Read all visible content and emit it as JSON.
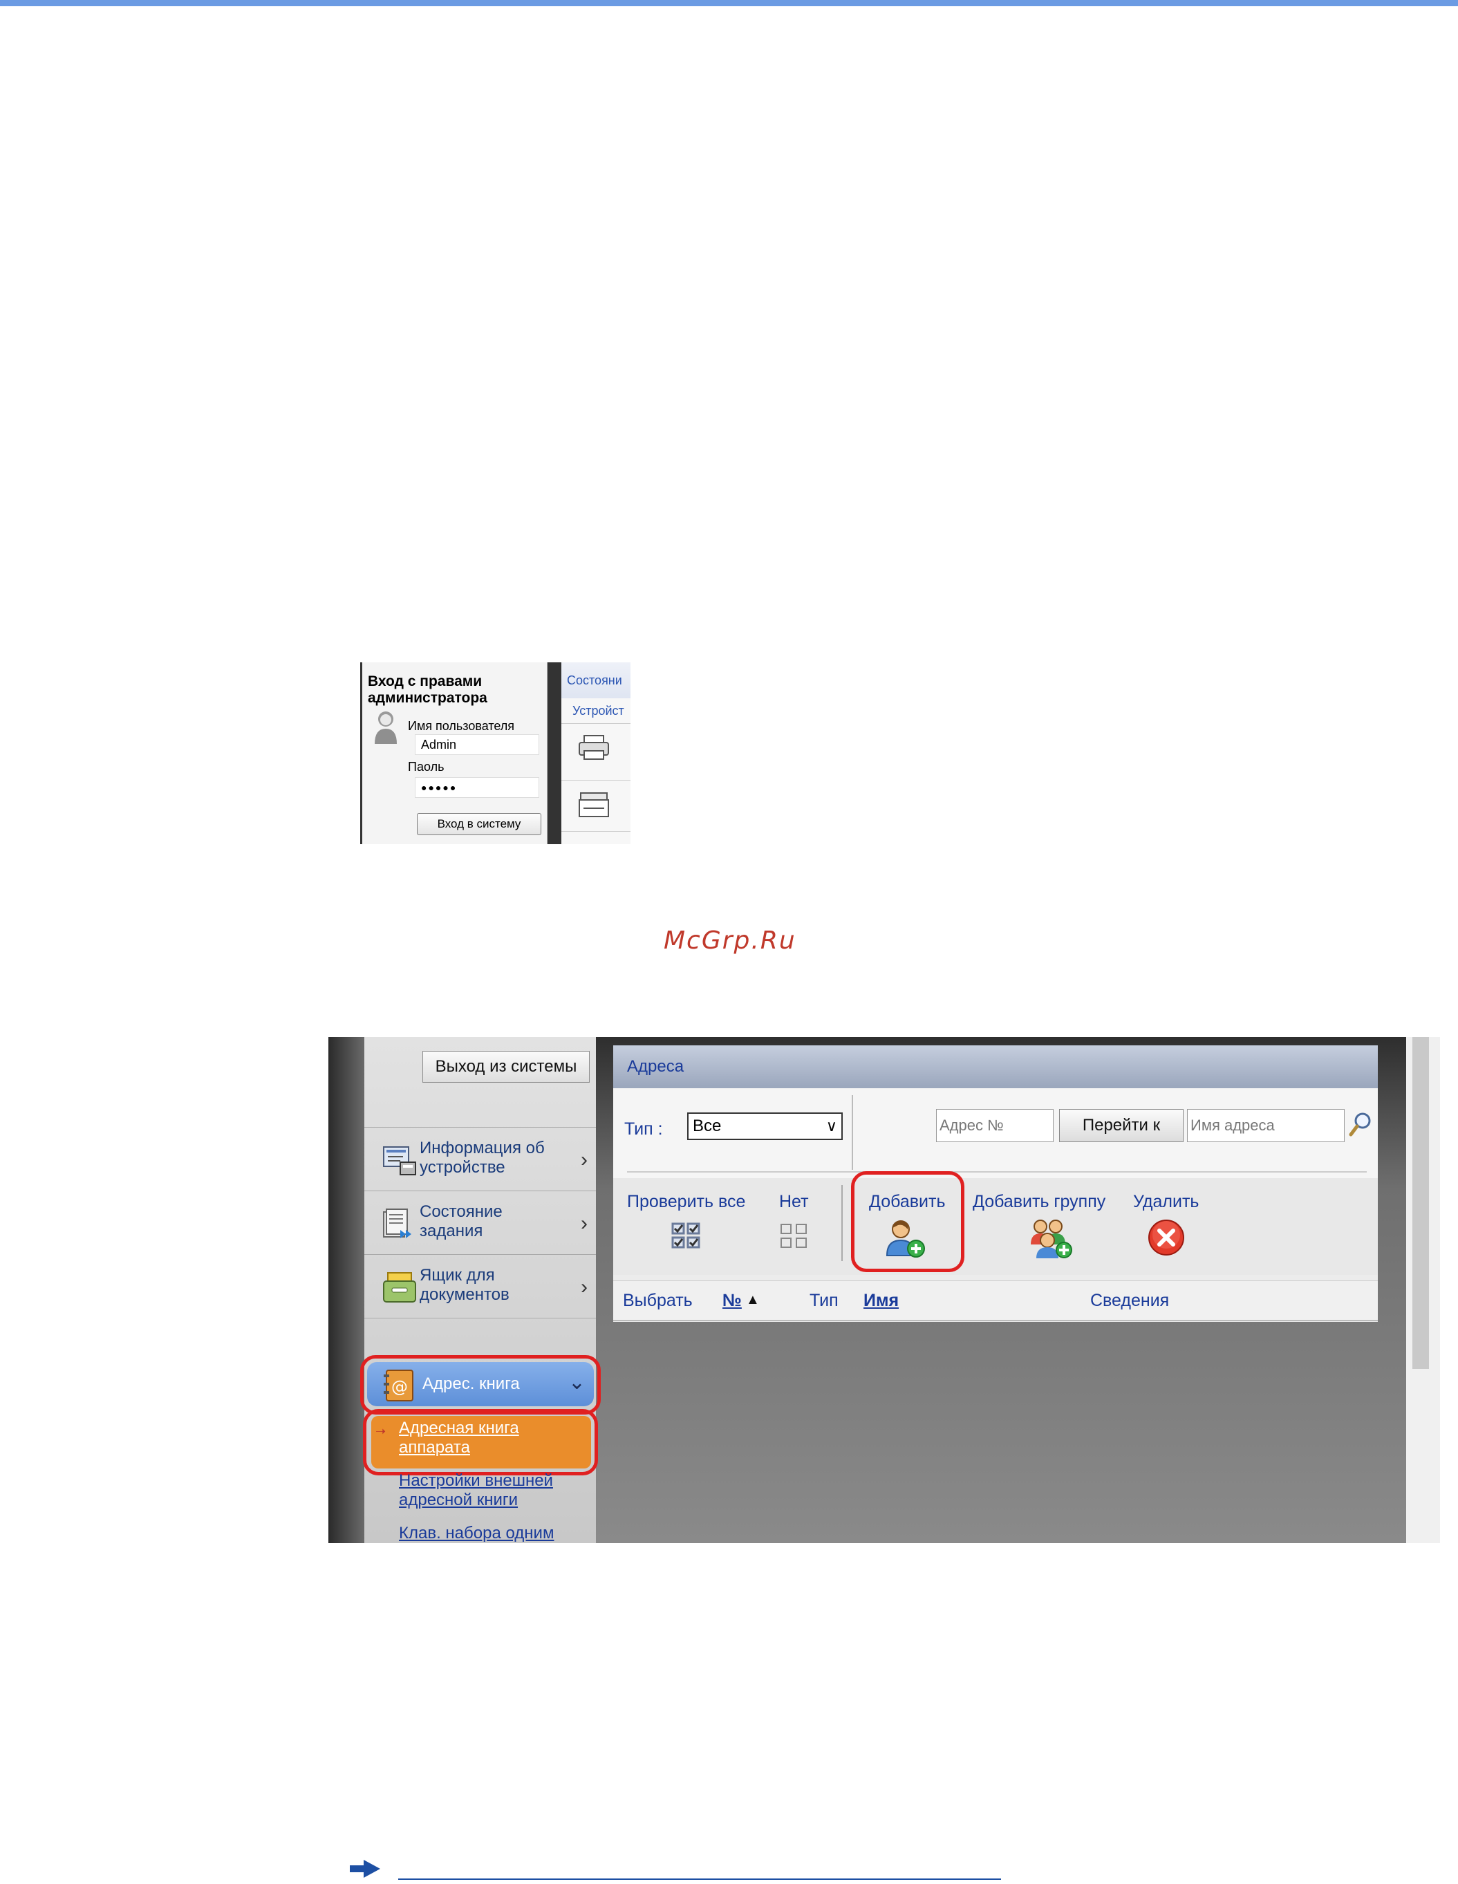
{
  "login": {
    "title": "Вход с правами администратора",
    "username_label": "Имя пользователя",
    "username_value": "Admin",
    "password_label": "Паоль",
    "password_value": "●●●●●",
    "login_button": "Вход в систему",
    "tab_label": "Состояни",
    "subtab_label": "Устройст"
  },
  "watermark": "McGrp.Ru",
  "addressbook": {
    "logout_button": "Выход из системы",
    "nav": [
      {
        "label": "Информация об устройстве",
        "icon": "device-info-icon"
      },
      {
        "label": "Состояние задания",
        "icon": "job-status-icon"
      },
      {
        "label": "Ящик для документов",
        "icon": "document-box-icon"
      },
      {
        "label": "Адрес. книга",
        "icon": "address-book-icon"
      }
    ],
    "subnav": [
      {
        "label": "Адресная книга аппарата",
        "active": true
      },
      {
        "label": "Настройки внешней адресной книги",
        "active": false
      },
      {
        "label": "Клав. набора одним",
        "active": false
      }
    ],
    "panel_title": "Адреса",
    "type_label": "Тип :",
    "type_value": "Все",
    "address_no_placeholder": "Адрес №",
    "goto_button": "Перейти к",
    "address_name_placeholder": "Имя адреса",
    "actions": {
      "check_all": "Проверить все",
      "none": "Нет",
      "add": "Добавить",
      "add_group": "Добавить группу",
      "delete": "Удалить"
    },
    "columns": {
      "select": "Выбрать",
      "number": "№",
      "type": "Тип",
      "name": "Имя",
      "details": "Сведения"
    }
  },
  "colors": {
    "highlight_ring": "#e02020",
    "active_subnav": "#ea8d2b",
    "active_nav": "#6f9ee0",
    "link": "#1a3b9a"
  }
}
